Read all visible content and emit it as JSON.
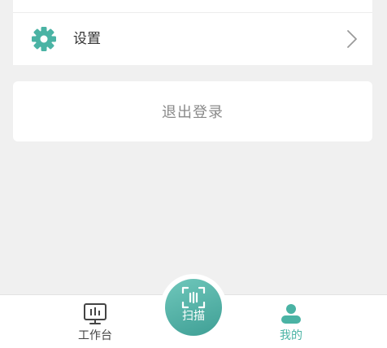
{
  "settings": {
    "label": "设置",
    "icon": "gear-icon",
    "chevron": "chevron-right-icon"
  },
  "logout": {
    "label": "退出登录"
  },
  "tabbar": {
    "items": [
      {
        "label": "工作台",
        "icon": "workbench-icon"
      },
      {
        "label": "扫描",
        "icon": "scan-icon"
      },
      {
        "label": "我的",
        "icon": "user-icon"
      }
    ],
    "active": "我的"
  },
  "colors": {
    "accent": "#4ab3a4",
    "scan_gradient_start": "#6fc7bb",
    "scan_gradient_end": "#3f9f95",
    "background": "#f0f0f0",
    "text": "#333333",
    "muted_text": "#8a8a8a"
  }
}
